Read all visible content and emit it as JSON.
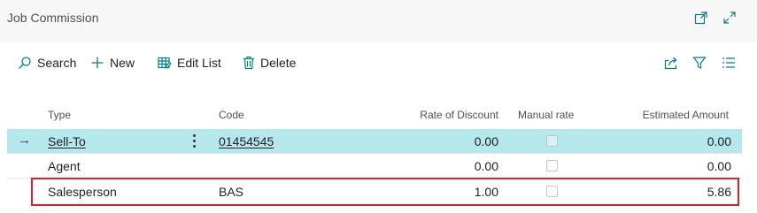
{
  "window": {
    "title": "Job Commission",
    "icons": {
      "open_in_new": "open-in-new-window-icon",
      "expand": "expand-icon"
    }
  },
  "actions": {
    "search": "Search",
    "new": "New",
    "edit_list": "Edit List",
    "delete": "Delete",
    "right_icons": [
      "share-icon",
      "filter-icon",
      "list-view-icon"
    ]
  },
  "columns": {
    "type": "Type",
    "code": "Code",
    "rate_of_discount": "Rate of Discount",
    "manual_rate": "Manual rate",
    "estimated_amount": "Estimated Amount"
  },
  "rows": [
    {
      "type": "Sell-To",
      "code": "01454545",
      "rate_of_discount": "0.00",
      "manual_rate": false,
      "estimated_amount": "0.00",
      "selected": true
    },
    {
      "type": "Agent",
      "code": "",
      "rate_of_discount": "0.00",
      "manual_rate": false,
      "estimated_amount": "0.00",
      "selected": false
    },
    {
      "type": "Salesperson",
      "code": "BAS",
      "rate_of_discount": "1.00",
      "manual_rate": false,
      "estimated_amount": "5.86",
      "selected": false,
      "highlighted": true
    }
  ],
  "colors": {
    "accent": "#0a7a83",
    "selected_row": "#b5e7ec",
    "highlight_border": "#d9222a"
  }
}
